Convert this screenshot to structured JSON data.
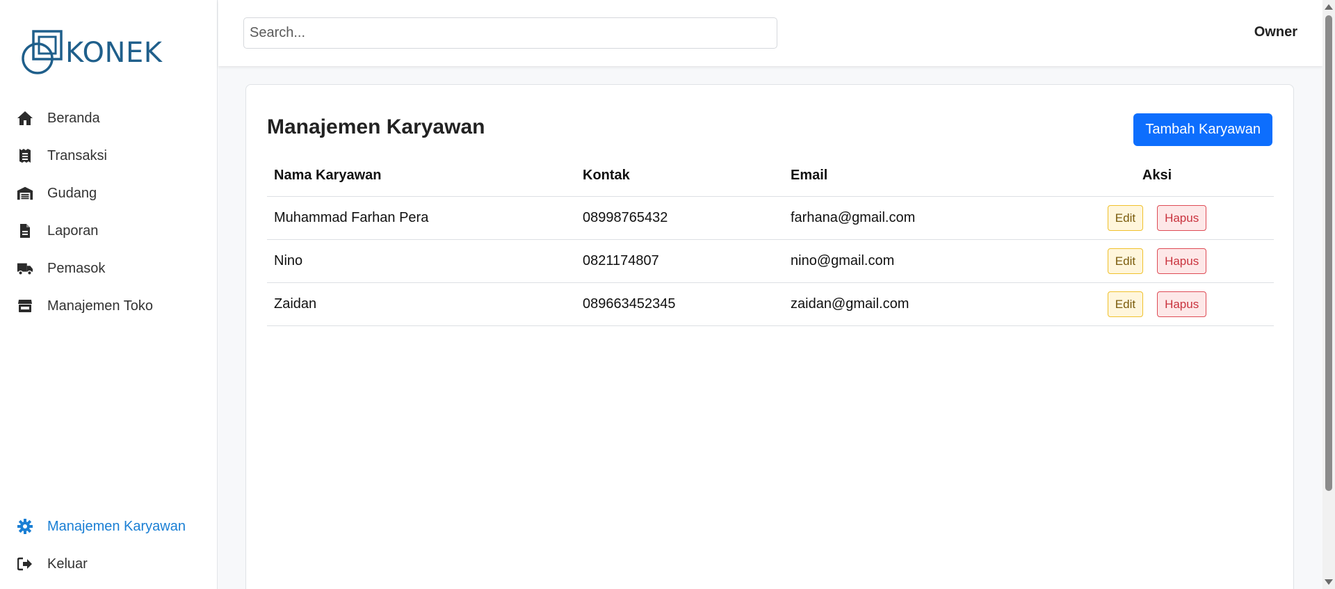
{
  "brand": {
    "name": "KONEK",
    "color": "#1f5f8b"
  },
  "sidebar": {
    "items": [
      {
        "label": "Beranda",
        "icon": "home-icon"
      },
      {
        "label": "Transaksi",
        "icon": "receipt-icon"
      },
      {
        "label": "Gudang",
        "icon": "warehouse-icon"
      },
      {
        "label": "Laporan",
        "icon": "file-icon"
      },
      {
        "label": "Pemasok",
        "icon": "truck-icon"
      },
      {
        "label": "Manajemen Toko",
        "icon": "store-icon"
      }
    ],
    "bottom_items": [
      {
        "label": "Manajemen Karyawan",
        "icon": "gear-icon",
        "active": true
      },
      {
        "label": "Keluar",
        "icon": "sign-out-icon"
      }
    ],
    "active_color": "#1a7fd4"
  },
  "topbar": {
    "search_placeholder": "Search...",
    "user_role": "Owner"
  },
  "main": {
    "title": "Manajemen Karyawan",
    "add_button_label": "Tambah Karyawan",
    "table": {
      "headers": [
        "Nama Karyawan",
        "Kontak",
        "Email",
        "Aksi"
      ],
      "rows": [
        {
          "name": "Muhammad Farhan Pera",
          "contact": "08998765432",
          "email": "farhana@gmail.com"
        },
        {
          "name": "Nino",
          "contact": "0821174807",
          "email": "nino@gmail.com"
        },
        {
          "name": "Zaidan",
          "contact": "089663452345",
          "email": "zaidan@gmail.com"
        }
      ],
      "edit_label": "Edit",
      "delete_label": "Hapus"
    },
    "colors": {
      "primary": "#0d6efd",
      "warning": "#f0c12c",
      "danger": "#de4b55"
    }
  }
}
